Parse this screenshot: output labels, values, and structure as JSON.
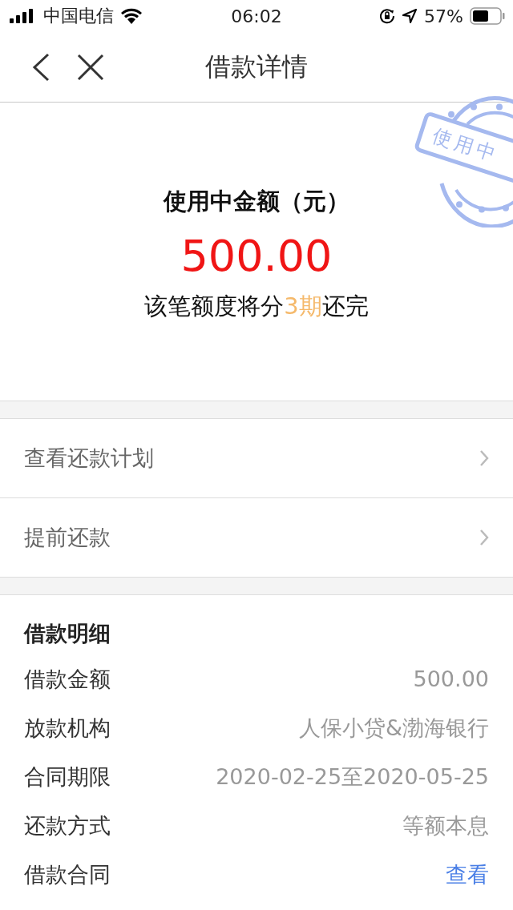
{
  "status_bar": {
    "carrier": "中国电信",
    "time": "06:02",
    "battery": "57%"
  },
  "nav": {
    "title": "借款详情"
  },
  "stamp": {
    "label": "使用中"
  },
  "summary": {
    "label": "使用中金额（元）",
    "amount": "500.00",
    "note_before": "该笔额度将分",
    "note_highlight": "3期",
    "note_after": "还完"
  },
  "actions": [
    {
      "label": "查看还款计划"
    },
    {
      "label": "提前还款"
    }
  ],
  "details": {
    "title": "借款明细",
    "rows": [
      {
        "label": "借款金额",
        "value": "500.00",
        "kind": "text"
      },
      {
        "label": "放款机构",
        "value": "人保小贷&渤海银行",
        "kind": "text"
      },
      {
        "label": "合同期限",
        "value": "2020-02-25至2020-05-25",
        "kind": "text"
      },
      {
        "label": "还款方式",
        "value": "等额本息",
        "kind": "text"
      },
      {
        "label": "借款合同",
        "value": "查看",
        "kind": "link"
      }
    ]
  }
}
